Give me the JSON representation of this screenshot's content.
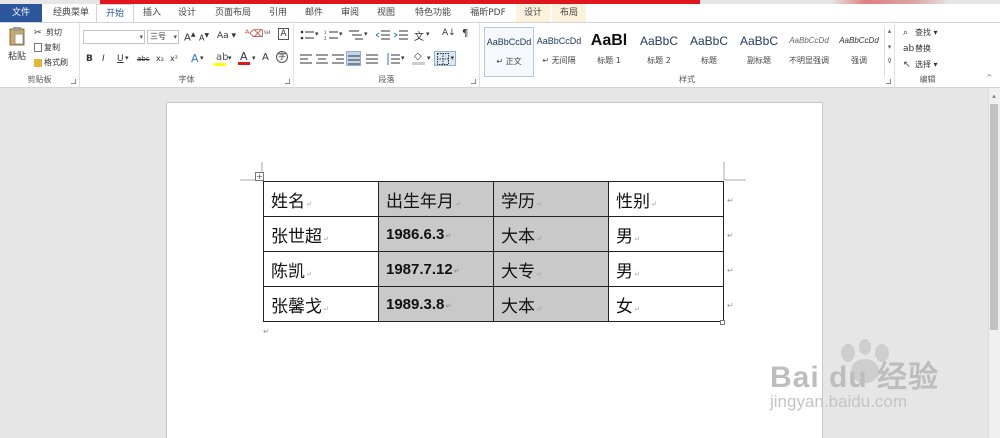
{
  "tabs": [
    "文件",
    "经典菜单",
    "开始",
    "插入",
    "设计",
    "页面布局",
    "引用",
    "邮件",
    "审阅",
    "视图",
    "特色功能",
    "福昕PDF",
    "设计",
    "布局"
  ],
  "clipboard": {
    "paste_label": "粘贴",
    "cut_label": "剪切",
    "copy_label": "复制",
    "format_painter_label": "格式刷",
    "group_label": "剪贴板"
  },
  "font": {
    "font_name": "",
    "font_size": "三号",
    "grow_label": "A",
    "shrink_label": "A",
    "case_label": "Aa",
    "bold": "B",
    "italic": "I",
    "underline": "U",
    "strike": "abc",
    "subscript": "x₂",
    "superscript": "x²",
    "group_label": "字体"
  },
  "paragraph": {
    "group_label": "段落"
  },
  "styles": {
    "items": [
      {
        "sample": "AaBbCcDd",
        "name": "↵ 正文"
      },
      {
        "sample": "AaBbCcDd",
        "name": "↵ 无间隔"
      },
      {
        "sample": "AaBl",
        "name": "标题 1"
      },
      {
        "sample": "AaBbC",
        "name": "标题 2"
      },
      {
        "sample": "AaBbC",
        "name": "标题"
      },
      {
        "sample": "AaBbC",
        "name": "副标题"
      },
      {
        "sample": "AaBbCcDd",
        "name": "不明显强调"
      },
      {
        "sample": "AaBbCcDd",
        "name": "强调"
      }
    ],
    "group_label": "样式"
  },
  "editing": {
    "find_label": "查找",
    "replace_label": "替换",
    "select_label": "选择",
    "group_label": "编辑"
  },
  "table": {
    "headers": [
      "姓名",
      "出生年月",
      "学历",
      "性别"
    ],
    "rows": [
      [
        "张世超",
        "1986.6.3",
        "大本",
        "男"
      ],
      [
        "陈凯",
        "1987.7.12",
        "大专",
        "男"
      ],
      [
        "张馨戈",
        "1989.3.8",
        "大本",
        "女"
      ]
    ]
  },
  "watermark": {
    "brand": "Bai du 经验",
    "url": "jingyan.baidu.com"
  },
  "colors": {
    "file_tab": "#2b579a",
    "cell_shade": "#c9c9c9",
    "accent_red": "#e0161c"
  }
}
